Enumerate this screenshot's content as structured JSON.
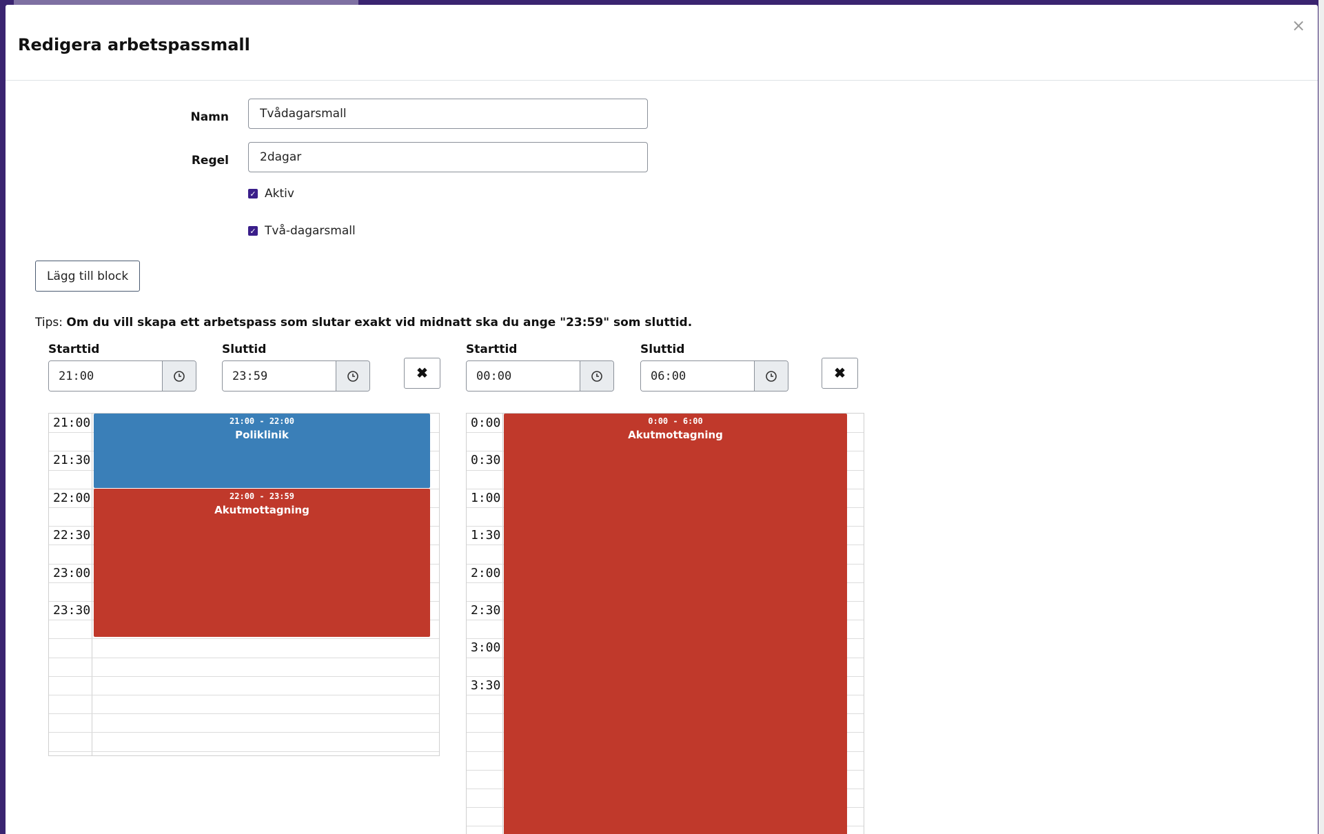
{
  "modal": {
    "title": "Redigera arbetspassmall",
    "close_glyph": "×"
  },
  "form": {
    "name_label": "Namn",
    "name_value": "Tvådagarsmall",
    "rule_label": "Regel",
    "rule_value": "2dagar",
    "active_label": "Aktiv",
    "active_checked": true,
    "two_day_label": "Två-dagarsmall",
    "two_day_checked": true
  },
  "add_block_label": "Lägg till block",
  "tips": {
    "prefix": "Tips: ",
    "text": "Om du vill skapa ett arbetspass som slutar exakt vid midnatt ska du ange \"23:59\" som sluttid."
  },
  "blocks": [
    {
      "start_label": "Starttid",
      "start_value": "21:00",
      "end_label": "Sluttid",
      "end_value": "23:59",
      "remove_glyph": "✖",
      "ticks": [
        "21:00",
        "21:30",
        "22:00",
        "22:30",
        "23:00",
        "23:30"
      ],
      "events": [
        {
          "time": "21:00 - 22:00",
          "title": "Poliklinik",
          "color": "#3a7fb8",
          "start_min": 0,
          "end_min": 60
        },
        {
          "time": "22:00 - 23:59",
          "title": "Akutmottagning",
          "color": "#c0392b",
          "start_min": 60,
          "end_min": 179
        }
      ]
    },
    {
      "start_label": "Starttid",
      "start_value": "00:00",
      "end_label": "Sluttid",
      "end_value": "06:00",
      "remove_glyph": "✖",
      "ticks": [
        "0:00",
        "0:30",
        "1:00",
        "1:30",
        "2:00",
        "2:30",
        "3:00",
        "3:30"
      ],
      "events": [
        {
          "time": "0:00 - 6:00",
          "title": "Akutmottagning",
          "color": "#c0392b",
          "start_min": 0,
          "end_min": 360
        }
      ]
    }
  ],
  "icons": {
    "clock": "clock-icon",
    "check": "check-icon",
    "close": "close-icon"
  }
}
